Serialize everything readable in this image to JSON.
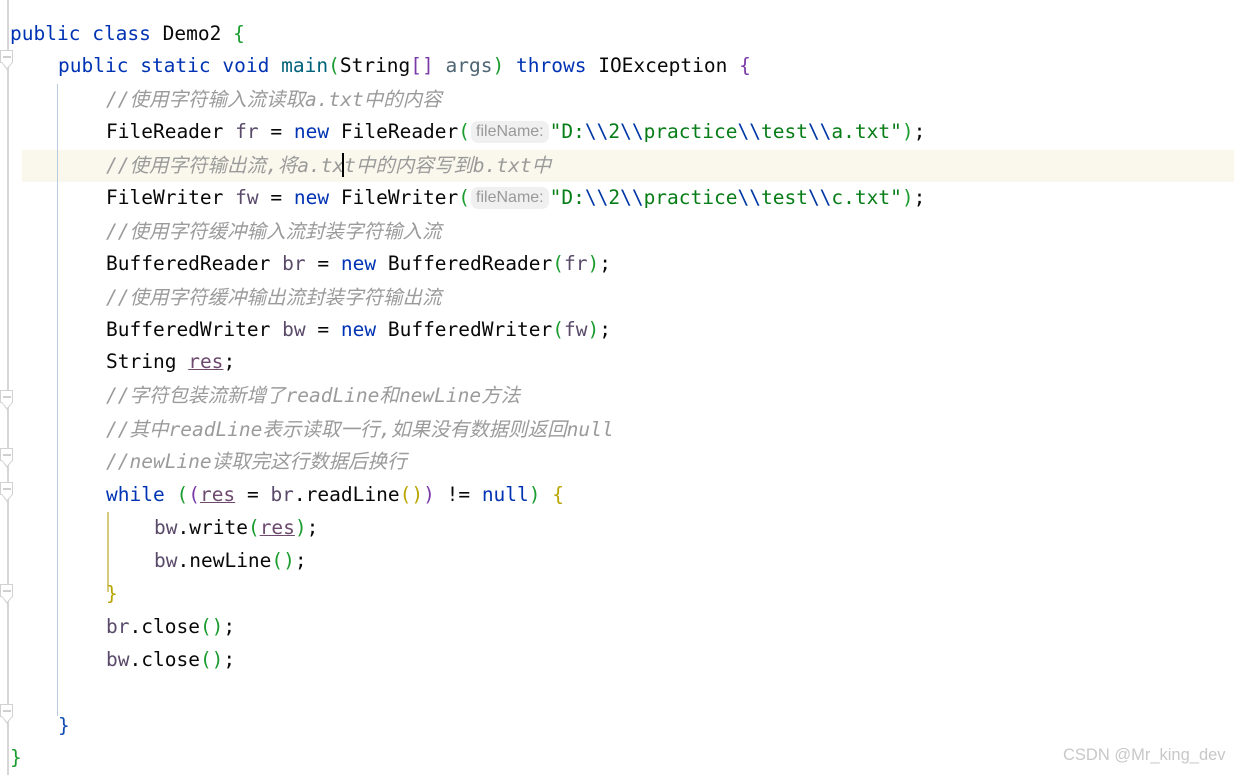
{
  "editor": {
    "language": "java",
    "background_color": "#ffffff",
    "caret_line_color": "#faf8ec",
    "caret_line_index": 4,
    "font_size_px": 19.5,
    "line_height_px": 32
  },
  "watermark": {
    "text": "CSDN @Mr_king_dev",
    "color": "#c8c8c8"
  },
  "gutter": {
    "fold_markers_label": "fold-region-arrow",
    "fold_marker_count": 5
  },
  "inlay_hints": {
    "file_name_param": "fileName:"
  },
  "code": {
    "lines": [
      {
        "n": 1,
        "indent": 0,
        "text": "public class Demo2 {"
      },
      {
        "n": 2,
        "indent": 1,
        "text": "public static void main(String[] args) throws IOException {"
      },
      {
        "n": 3,
        "indent": 2,
        "text": "//使用字符输入流读取a.txt中的内容"
      },
      {
        "n": 4,
        "indent": 2,
        "text": "FileReader fr = new FileReader( fileName: \"D:\\\\2\\\\practice\\\\test\\\\a.txt\");"
      },
      {
        "n": 5,
        "indent": 2,
        "text": "//使用字符输出流,将a.txt中的内容写到b.txt中"
      },
      {
        "n": 6,
        "indent": 2,
        "text": "FileWriter fw = new FileWriter( fileName: \"D:\\\\2\\\\practice\\\\test\\\\c.txt\");"
      },
      {
        "n": 7,
        "indent": 2,
        "text": "//使用字符缓冲输入流封装字符输入流"
      },
      {
        "n": 8,
        "indent": 2,
        "text": "BufferedReader br = new BufferedReader(fr);"
      },
      {
        "n": 9,
        "indent": 2,
        "text": "//使用字符缓冲输出流封装字符输出流"
      },
      {
        "n": 10,
        "indent": 2,
        "text": "BufferedWriter bw = new BufferedWriter(fw);"
      },
      {
        "n": 11,
        "indent": 2,
        "text": "String res;"
      },
      {
        "n": 12,
        "indent": 2,
        "text": "//字符包装流新增了readLine和newLine方法"
      },
      {
        "n": 13,
        "indent": 2,
        "text": "//其中readLine表示读取一行,如果没有数据则返回null"
      },
      {
        "n": 14,
        "indent": 2,
        "text": "//newLine读取完这行数据后换行"
      },
      {
        "n": 15,
        "indent": 2,
        "text": "while ((res = br.readLine()) != null) {"
      },
      {
        "n": 16,
        "indent": 3,
        "text": "bw.write(res);"
      },
      {
        "n": 17,
        "indent": 3,
        "text": "bw.newLine();"
      },
      {
        "n": 18,
        "indent": 2,
        "text": "}"
      },
      {
        "n": 19,
        "indent": 2,
        "text": "br.close();"
      },
      {
        "n": 20,
        "indent": 2,
        "text": "bw.close();"
      },
      {
        "n": 21,
        "indent": 0,
        "text": ""
      },
      {
        "n": 22,
        "indent": 1,
        "text": "}"
      },
      {
        "n": 23,
        "indent": 0,
        "text": "}"
      }
    ],
    "tokens": {
      "keywords": [
        "public",
        "class",
        "static",
        "void",
        "throws",
        "new",
        "while",
        "null"
      ],
      "types": [
        "Demo2",
        "String",
        "IOException",
        "FileReader",
        "FileWriter",
        "BufferedReader",
        "BufferedWriter"
      ],
      "methods": [
        "main",
        "readLine",
        "write",
        "newLine",
        "close"
      ],
      "variables": [
        "fr",
        "fw",
        "br",
        "bw",
        "res",
        "args"
      ],
      "strings": [
        "\"D:\\\\2\\\\practice\\\\test\\\\a.txt\"",
        "\"D:\\\\2\\\\practice\\\\test\\\\c.txt\""
      ]
    },
    "colors": {
      "keyword": "#0033b3",
      "string": "#067d17",
      "escape": "#0037a6",
      "comment": "#9b9b9b",
      "method_decl": "#00627a",
      "parameter": "#4e6573",
      "local_var": "#5a4a6a",
      "plain": "#080808",
      "bracket_green": "#1a9c2e",
      "bracket_purple": "#7c3aa8",
      "bracket_yellow": "#b8a500",
      "bracket_blue": "#0f4bb3"
    }
  }
}
